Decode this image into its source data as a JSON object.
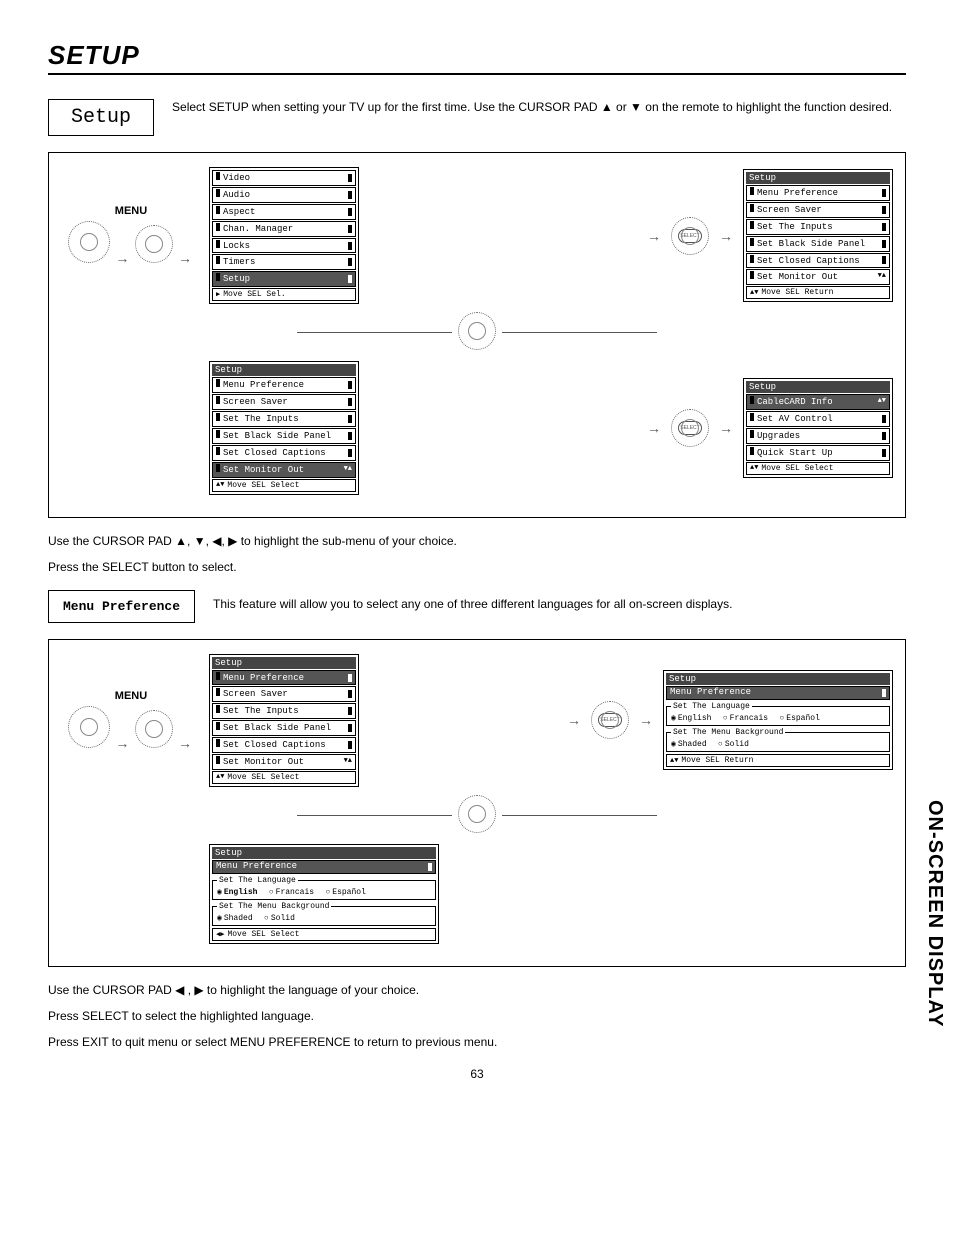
{
  "title": "SETUP",
  "setup": {
    "label": "Setup",
    "desc": "Select SETUP when setting your TV up for the first time.  Use the CURSOR PAD ▲ or ▼ on the remote to highlight the function desired."
  },
  "menu_label": "MENU",
  "select_label": "SELECT",
  "osd_main": {
    "items": [
      "Video",
      "Audio",
      "Aspect",
      "Chan. Manager",
      "Locks",
      "Timers",
      "Setup"
    ],
    "highlight": "Setup",
    "footer": "Move  SEL  Sel."
  },
  "osd_setup1": {
    "title": "Setup",
    "items": [
      "Menu Preference",
      "Screen Saver",
      "Set The Inputs",
      "Set Black Side Panel",
      "Set Closed Captions",
      "Set Monitor Out"
    ],
    "footer": "Move  SEL  Return"
  },
  "osd_setup2": {
    "title": "Setup",
    "items": [
      "Menu Preference",
      "Screen Saver",
      "Set The Inputs",
      "Set Black Side Panel",
      "Set Closed Captions",
      "Set Monitor Out"
    ],
    "highlight": "Set Monitor Out",
    "footer": "Move  SEL  Select"
  },
  "osd_setup3": {
    "title": "Setup",
    "items": [
      "CableCARD Info",
      "Set AV Control",
      "Upgrades",
      "Quick Start Up"
    ],
    "highlight": "CableCARD Info",
    "footer": "Move  SEL  Select"
  },
  "mid_text1": "Use the CURSOR PAD ▲, ▼, ◀, ▶ to highlight the sub-menu of your choice.",
  "mid_text2": "Press the SELECT button to select.",
  "menu_pref": {
    "label": "Menu Preference",
    "desc": "This feature will allow you to select any one of three different languages for all on-screen displays."
  },
  "osd_pref1": {
    "title": "Setup",
    "items": [
      "Menu Preference",
      "Screen Saver",
      "Set The Inputs",
      "Set Black Side Panel",
      "Set Closed Captions",
      "Set Monitor Out"
    ],
    "highlight": "Menu Preference",
    "footer": "Move  SEL  Select"
  },
  "osd_lang": {
    "title": "Setup",
    "sub": "Menu Preference",
    "group1_label": "Set The Language",
    "langs": [
      "English",
      "Francais",
      "Español"
    ],
    "group2_label": "Set The Menu Background",
    "bgs": [
      "Shaded",
      "Solid"
    ],
    "footer": "Move  SEL  Return",
    "footer2": "Move  SEL  Select"
  },
  "end_text1": "Use the CURSOR PAD ◀ , ▶ to highlight the language of your choice.",
  "end_text2": "Press SELECT to select the highlighted language.",
  "end_text3": "Press EXIT to quit menu or select MENU PREFERENCE to return to previous menu.",
  "side_tab": "ON-SCREEN DISPLAY",
  "page_num": "63"
}
